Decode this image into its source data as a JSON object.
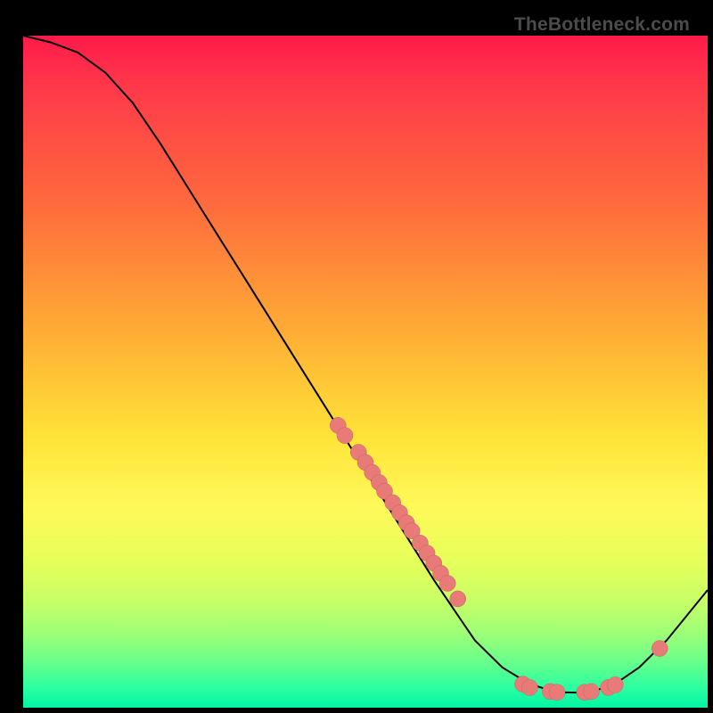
{
  "watermark": "TheBottleneck.com",
  "chart_data": {
    "type": "line",
    "title": "",
    "xlabel": "",
    "ylabel": "",
    "xlim": [
      0,
      100
    ],
    "ylim": [
      0,
      100
    ],
    "note": "No axis ticks or numeric labels are visible; x/y values are normalized 0–100 estimates from pixel positions.",
    "series": [
      {
        "name": "curve",
        "x": [
          0,
          4,
          8,
          12,
          16,
          20,
          24,
          28,
          32,
          36,
          40,
          44,
          48,
          52,
          56,
          60,
          64,
          66,
          70,
          74,
          78,
          82,
          86,
          90,
          94,
          98,
          100
        ],
        "y": [
          100,
          99,
          97.5,
          94.5,
          90,
          84,
          77.5,
          71,
          64.5,
          58,
          51.5,
          45,
          38.5,
          32,
          25.5,
          19,
          13,
          10,
          6,
          3.5,
          2.3,
          2.2,
          3.2,
          6,
          10,
          15,
          17.5
        ]
      }
    ],
    "marker_clusters": [
      {
        "name": "descending-cluster",
        "points": [
          {
            "x": 46,
            "y": 42
          },
          {
            "x": 47,
            "y": 40.5
          },
          {
            "x": 49,
            "y": 38
          },
          {
            "x": 50,
            "y": 36.5
          },
          {
            "x": 51,
            "y": 35
          },
          {
            "x": 52,
            "y": 33.5
          },
          {
            "x": 52.8,
            "y": 32.2
          },
          {
            "x": 54,
            "y": 30.5
          },
          {
            "x": 55,
            "y": 29
          },
          {
            "x": 56,
            "y": 27.5
          },
          {
            "x": 56.8,
            "y": 26.3
          },
          {
            "x": 58,
            "y": 24.5
          },
          {
            "x": 59,
            "y": 23
          },
          {
            "x": 60,
            "y": 21.5
          },
          {
            "x": 61,
            "y": 20
          },
          {
            "x": 62,
            "y": 18.5
          },
          {
            "x": 63.5,
            "y": 16.2
          }
        ]
      },
      {
        "name": "valley-cluster",
        "points": [
          {
            "x": 73,
            "y": 3.5
          },
          {
            "x": 74,
            "y": 3.0
          },
          {
            "x": 77,
            "y": 2.4
          },
          {
            "x": 78,
            "y": 2.3
          },
          {
            "x": 82,
            "y": 2.3
          },
          {
            "x": 83,
            "y": 2.4
          },
          {
            "x": 85.5,
            "y": 3.0
          },
          {
            "x": 86.5,
            "y": 3.4
          }
        ]
      },
      {
        "name": "ascending-single",
        "points": [
          {
            "x": 93,
            "y": 8.8
          }
        ]
      }
    ],
    "marker_radius_px": 9,
    "background_gradient": {
      "top": "#ff1a4a",
      "upper_mid": "#ffb035",
      "mid": "#ffe438",
      "lower_mid": "#c8ff66",
      "bottom": "#00f5a6"
    }
  }
}
